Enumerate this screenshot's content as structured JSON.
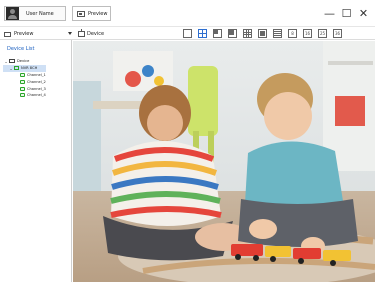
{
  "titlebar": {
    "user_tab": "User Name",
    "preview_tab": "Preview",
    "window_buttons": [
      "—",
      "☐",
      "✕"
    ]
  },
  "toolbar": {
    "mode_select": "Preview",
    "device_label": "Device",
    "layout_buttons": [
      "1x1",
      "2x2",
      "1+5",
      "1+7",
      "3x3",
      "4x4",
      "5x5",
      "8",
      "16",
      "25",
      "36"
    ]
  },
  "sidebar": {
    "title": "Device List",
    "root": "Device",
    "device": "NVR 8CH",
    "channels": [
      "Channel_1",
      "Channel_2",
      "Channel_3",
      "Channel_4"
    ]
  },
  "video": {
    "description_icon": "camera-feed"
  }
}
